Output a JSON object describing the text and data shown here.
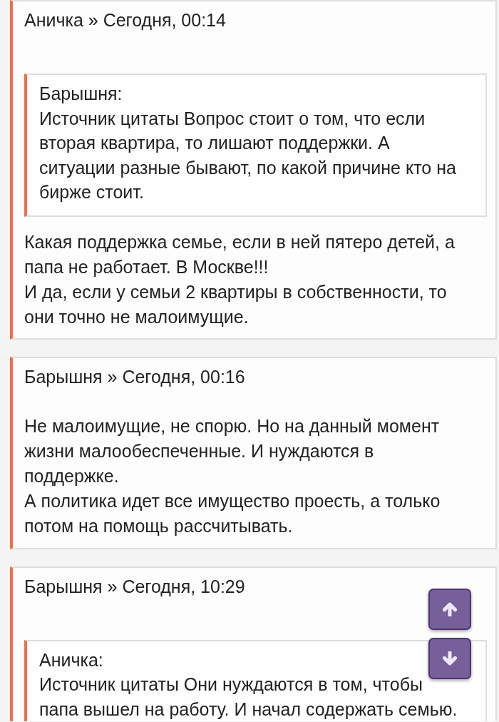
{
  "posts": [
    {
      "header": "Аничка » Сегодня, 00:14",
      "quote": {
        "author": "Барышня:",
        "text": "Источник цитаты Вопрос стоит о том, что если вторая квартира, то лишают поддержки. А ситуации разные бывают, по какой причине кто на бирже стоит."
      },
      "paragraphs": [
        "Какая поддержка семье, если в ней пятеро детей, а папа не работает. В Москве!!!",
        "И да, если у семьи 2 квартиры в собственности, то они точно не малоимущие."
      ]
    },
    {
      "header": "Барышня » Сегодня, 00:16",
      "paragraphs": [
        "Не малоимущие, не спорю. Но на данный момент жизни малообеспеченные. И нуждаются в поддержке.",
        "А политика идет все имущество проесть, а только потом на помощь рассчитывать."
      ]
    },
    {
      "header": "Барышня » Сегодня, 10:29",
      "quote": {
        "author": "Аничка:",
        "text": "Источник цитаты Они нуждаются в том, чтобы папа вышел на работу. И начал содержать семью."
      }
    }
  ],
  "scroll_buttons": [
    {
      "kind": "up"
    },
    {
      "kind": "down"
    }
  ]
}
